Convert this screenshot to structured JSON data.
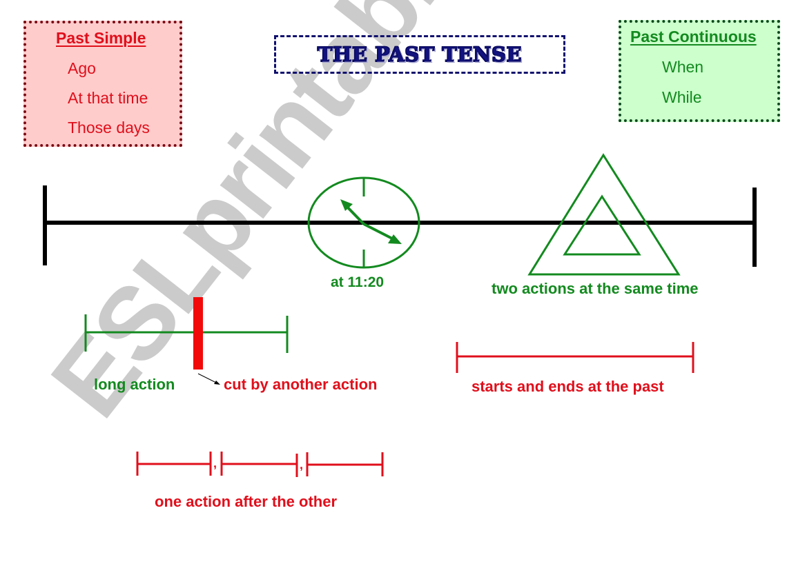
{
  "title": "THE PAST TENSE",
  "past_simple": {
    "heading": "Past Simple",
    "items": [
      "Ago",
      "At that time",
      "Those days"
    ]
  },
  "past_continuous": {
    "heading": "Past Continuous",
    "items": [
      "When",
      "While"
    ]
  },
  "timeline": {
    "clock_label": "at 11:20",
    "clock_time": "11:20",
    "triangles_label": "two actions at the same time"
  },
  "examples": {
    "long_action_label": "long action",
    "cut_label": "cut by another action",
    "past_span_label": "starts and ends at the past",
    "sequence_label": "one action after the other",
    "sequence_separator": ","
  },
  "watermark": "ESLprintables.com",
  "colors": {
    "red": "#e00f1b",
    "green": "#138a1f",
    "navy": "#121280",
    "black": "#000000"
  }
}
